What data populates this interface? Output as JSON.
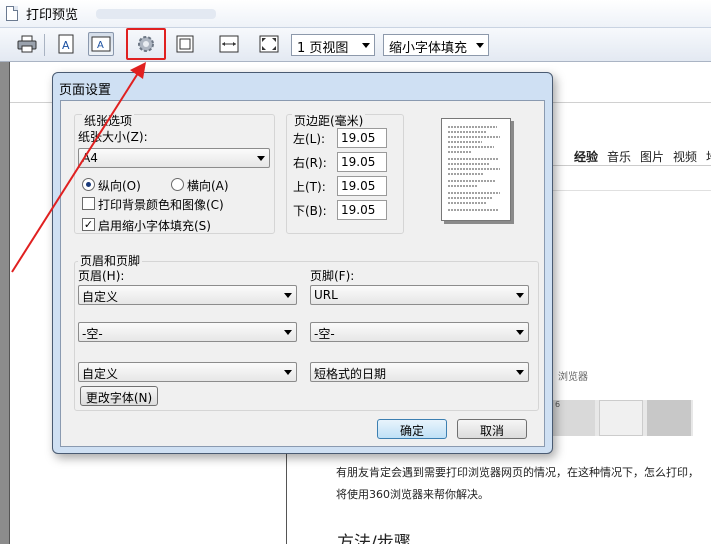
{
  "window": {
    "title": "打印预览"
  },
  "toolbar": {
    "zoom_combo": "1 页视图",
    "font_combo": "缩小字体填充"
  },
  "background_page": {
    "tabs": [
      "经验",
      "音乐",
      "图片",
      "视频",
      "地"
    ],
    "partial_text": "浏览器",
    "page_number": "6",
    "paragraph_line1": "有朋友肯定会遇到需要打印浏览器网页的情况，在这种情况下，怎么打印，",
    "paragraph_line2": "将使用360浏览器来帮你解决。",
    "heading": "方法/步骤"
  },
  "dialog": {
    "title": "页面设置",
    "paper_group": {
      "title": "纸张选项",
      "size_label": "纸张大小(Z):",
      "size_value": "A4",
      "portrait": "纵向(O)",
      "landscape": "横向(A)",
      "orientation_selected": "portrait",
      "print_bg": "打印背景颜色和图像(C)",
      "print_bg_checked": false,
      "shrink_fit": "启用缩小字体填充(S)",
      "shrink_fit_checked": true
    },
    "margins_group": {
      "title": "页边距(毫米)",
      "left_label": "左(L):",
      "left_value": "19.05",
      "right_label": "右(R):",
      "right_value": "19.05",
      "top_label": "上(T):",
      "top_value": "19.05",
      "bottom_label": "下(B):",
      "bottom_value": "19.05"
    },
    "header_footer_group": {
      "title": "页眉和页脚",
      "header_label": "页眉(H):",
      "footer_label": "页脚(F):",
      "header_1": "自定义",
      "header_2": "-空-",
      "header_3": "自定义",
      "footer_1": "URL",
      "footer_2": "-空-",
      "footer_3": "短格式的日期",
      "change_font": "更改字体(N)"
    },
    "ok": "确定",
    "cancel": "取消"
  },
  "colors": {
    "highlight": "#e02020",
    "arrow": "#e02020"
  }
}
